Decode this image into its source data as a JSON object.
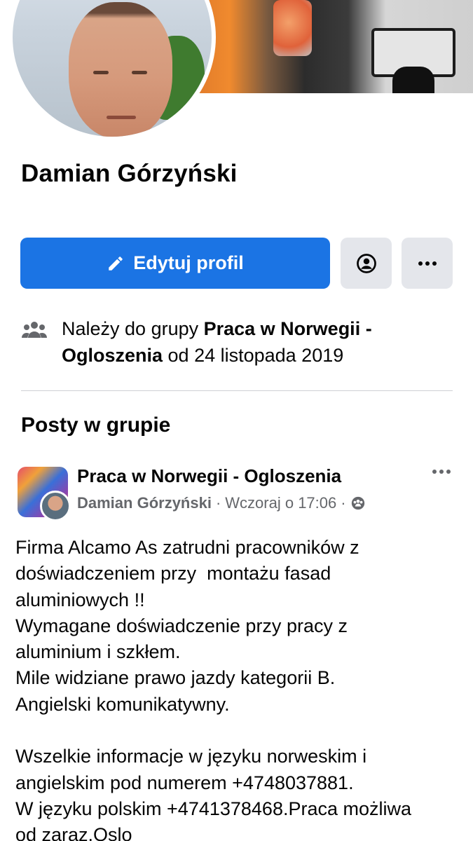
{
  "profile": {
    "name": "Damian Górzyński",
    "edit_label": "Edytuj profil",
    "edit_icon": "pencil-icon",
    "profile_icon": "user-circle-icon",
    "more_icon": "more-dots-icon"
  },
  "membership": {
    "icon": "group-icon",
    "prefix": "Należy do grupy ",
    "group": "Praca w Norwegii - Ogloszenia",
    "suffix": " od 24 listopada 2019"
  },
  "section": {
    "title": "Posty w grupie"
  },
  "post": {
    "group": "Praca w Norwegii - Ogloszenia",
    "author": "Damian Górzyński",
    "separator": "·",
    "time": "Wczoraj o 17:06",
    "audience_icon": "group-audience-icon",
    "body": "Firma Alcamo As zatrudni pracowników z\ndoświadczeniem przy  montażu fasad\naluminiowych !!\nWymagane doświadczenie przy pracy z\naluminium i szkłem.\nMile widziane prawo jazdy kategorii B.\nAngielski komunikatywny.\n\nWszelkie informacje w języku norweskim i\nangielskim pod numerem +4748037881.\nW języku polskim +4741378468.Praca możliwa\nod zaraz.Oslo"
  },
  "colors": {
    "primary": "#1b74e4",
    "secondary_button": "#e4e6eb",
    "meta_text": "#65676b"
  }
}
